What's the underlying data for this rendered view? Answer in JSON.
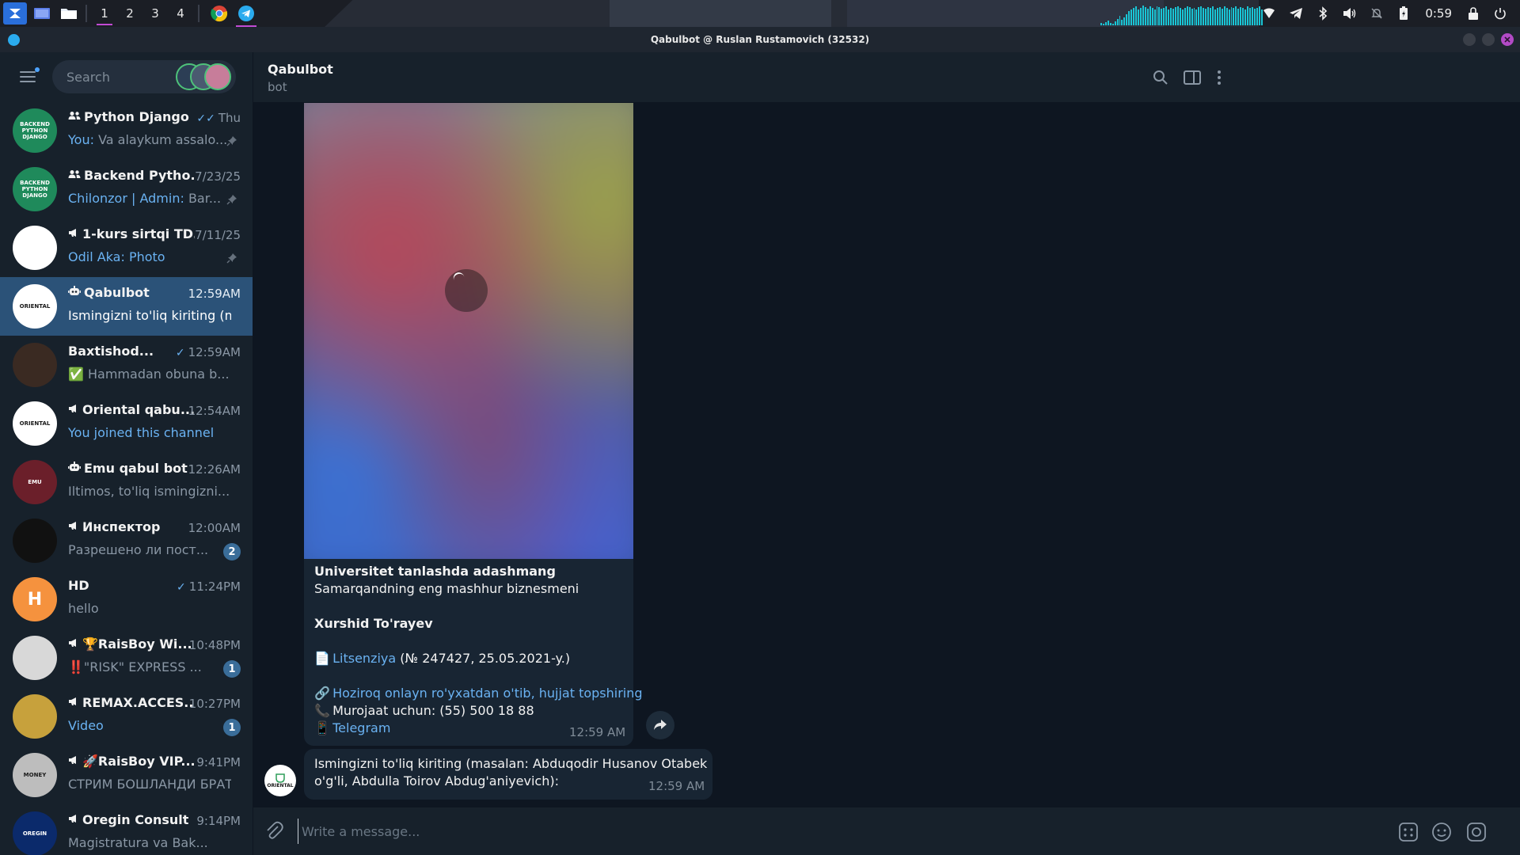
{
  "taskbar": {
    "workspaces": [
      "1",
      "2",
      "3",
      "4"
    ],
    "active_workspace": "1",
    "clock": "0:59",
    "icons": [
      "app-launcher-icon",
      "files-icon",
      "folder-icon",
      "chrome-icon",
      "telegram-icon",
      "wifi-icon",
      "telegram-tray-icon",
      "bluetooth-icon",
      "volume-icon",
      "notifications-off-icon",
      "battery-icon",
      "lock-icon",
      "power-icon"
    ]
  },
  "window": {
    "title": "Qabulbot @ Ruslan Rustamovich (32532)"
  },
  "search": {
    "placeholder": "Search"
  },
  "chats": [
    {
      "name": "Python Django ...",
      "type": "group",
      "time": "Thu",
      "read": "double",
      "sender": "You:",
      "preview": "Va alaykum assalo...",
      "pinned": true,
      "avatar_text": "BACKEND PYTHON DJANGO",
      "avatar_color": "#1f8a5b"
    },
    {
      "name": "Backend Pytho...",
      "type": "group",
      "time": "7/23/25",
      "sender": "Chilonzor | Admin:",
      "preview": "Bar...",
      "pinned": true,
      "avatar_text": "BACKEND PYTHON DJANGO",
      "avatar_color": "#1f8a5b"
    },
    {
      "name": "1-kurs sirtqi TD...",
      "type": "channel",
      "time": "7/11/25",
      "sender": "Odil Aka:",
      "preview": "Photo",
      "preview_link": true,
      "pinned": true,
      "avatar_color": "#ffffff"
    },
    {
      "name": "Qabulbot",
      "type": "bot",
      "time": "12:59AM",
      "preview": "Ismingizni to'liq kiriting (ma...",
      "active": true,
      "avatar_text": "ORIENTAL",
      "avatar_color": "#ffffff"
    },
    {
      "name": "Baxtishod...",
      "type": "user",
      "time": "12:59AM",
      "read": "single",
      "preview": "✅ Hammadan obuna b...",
      "avatar_color": "#3a2a22"
    },
    {
      "name": "Oriental qabu...",
      "type": "channel",
      "time": "12:54AM",
      "preview": "You joined this channel",
      "preview_link": true,
      "avatar_text": "ORIENTAL",
      "avatar_color": "#ffffff"
    },
    {
      "name": "Emu qabul bot",
      "type": "bot",
      "time": "12:26AM",
      "preview": "Iltimos, to'liq ismingizni...",
      "avatar_text": "EMU",
      "avatar_color": "#6b1f2a"
    },
    {
      "name": "Инспектор",
      "type": "channel",
      "time": "12:00AM",
      "preview": "Разрешено ли пост...",
      "badge": "2",
      "avatar_color": "#111111"
    },
    {
      "name": "HD",
      "type": "user",
      "time": "11:24PM",
      "read": "single",
      "preview": "hello",
      "avatar_text": "H",
      "avatar_color": "#f5923e"
    },
    {
      "name": "🏆RaisBoy Wi...",
      "type": "channel",
      "time": "10:48PM",
      "preview": "‼️\"RISK\" EXPRESS ...",
      "badge": "1",
      "avatar_color": "#d8d8d8"
    },
    {
      "name": "REMAX.ACCES...",
      "type": "channel",
      "time": "10:27PM",
      "preview": "Video",
      "preview_link": true,
      "badge": "1",
      "avatar_color": "#c7a13c"
    },
    {
      "name": "🚀RaisBoy VIP...",
      "type": "channel",
      "time": "9:41PM",
      "preview": "СТРИМ БОШЛАНДИ БРАТ...",
      "avatar_text": "MONEY",
      "avatar_color": "#bdbdbd"
    },
    {
      "name": "Oregin Consult",
      "type": "channel",
      "time": "9:14PM",
      "preview": "Magistratura va Bak...",
      "avatar_text": "OREGIN",
      "avatar_color": "#0b2a6b"
    }
  ],
  "chat_header": {
    "title": "Qabulbot",
    "subtitle": "bot"
  },
  "message1": {
    "title": "Universitet tanlashda adashmang",
    "line2": "Samarqandning eng mashhur biznesmeni",
    "line3": "Xurshid To'rayev",
    "license_link": "Litsenziya",
    "license_rest": "(№ 247427, 25.05.2021-y.)",
    "apply_link": "Hoziroq onlayn ro'yxatdan o'tib, hujjat topshiring",
    "contact": "Murojaat uchun: (55) 500 18 88",
    "telegram_link": "Telegram",
    "time": "12:59 AM"
  },
  "message2": {
    "line1": "Ismingizni to'liq kiriting (masalan: Abduqodir Husanov Otabek",
    "line2": "o'g'li, Abdulla Toirov Abdug'aniyevich):",
    "time": "12:59 AM",
    "avatar_text": "ORIENTAL"
  },
  "composer": {
    "placeholder": "Write a message..."
  },
  "colors": {
    "accent": "#6ab2f2",
    "active_chat": "#2b5278",
    "bubble": "#182533",
    "background": "#0e1621",
    "panel": "#17212b"
  }
}
